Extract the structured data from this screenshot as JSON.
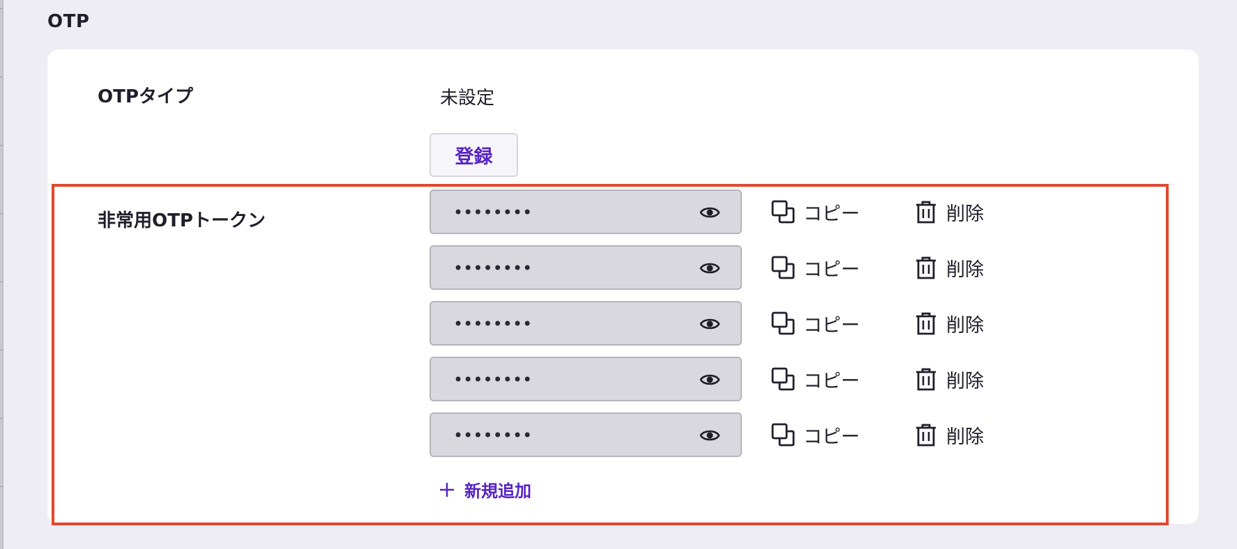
{
  "section": {
    "title": "OTP"
  },
  "otp_type": {
    "label": "OTPタイプ",
    "value": "未設定",
    "register_button": "登録"
  },
  "emergency_tokens": {
    "label": "非常用OTPトークン",
    "tokens": [
      {
        "masked_value": "••••••••",
        "copy_label": "コピー",
        "delete_label": "削除"
      },
      {
        "masked_value": "••••••••",
        "copy_label": "コピー",
        "delete_label": "削除"
      },
      {
        "masked_value": "••••••••",
        "copy_label": "コピー",
        "delete_label": "削除"
      },
      {
        "masked_value": "••••••••",
        "copy_label": "コピー",
        "delete_label": "削除"
      },
      {
        "masked_value": "••••••••",
        "copy_label": "コピー",
        "delete_label": "削除"
      }
    ],
    "add_label": "新規追加"
  },
  "icons": {
    "reveal": "eye-icon",
    "copy": "copy-icon",
    "delete": "trash-icon",
    "add": "plus-icon"
  },
  "colors": {
    "accent": "#5623c2",
    "highlight": "#e2472e",
    "background": "#eeedf3",
    "card": "#ffffff",
    "field": "#d9d8de"
  }
}
